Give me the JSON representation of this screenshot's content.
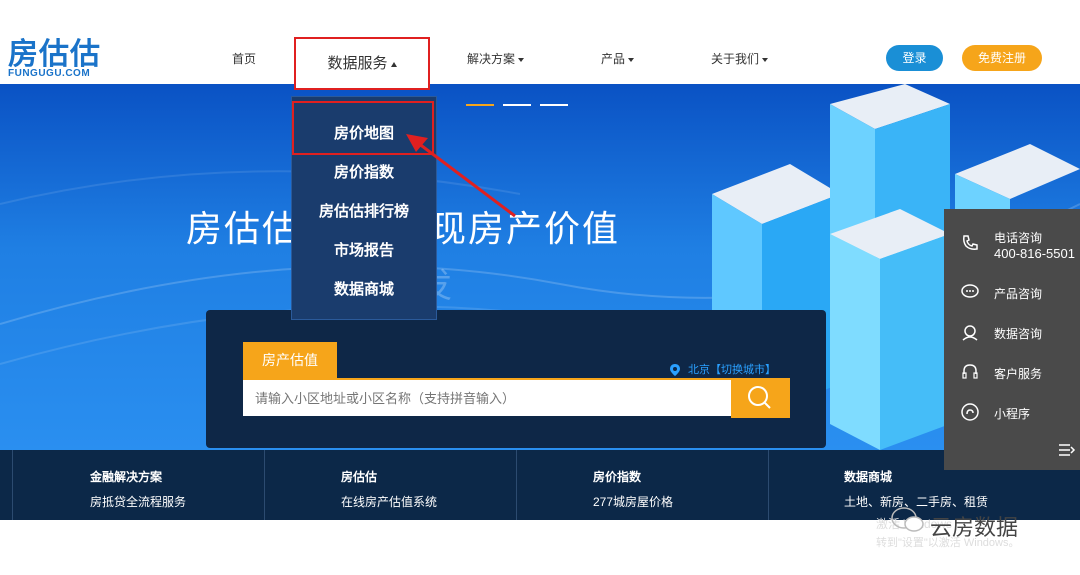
{
  "header": {
    "logo": "房估估",
    "logo_sub": "FUNGUGU.COM",
    "nav": {
      "home": "首页",
      "data_services": "数据服务",
      "solutions": "解决方案",
      "products": "产品",
      "about": "关于我们"
    },
    "login": "登录",
    "register": "免费注册"
  },
  "dropdown": {
    "items": [
      "房价地图",
      "房价指数",
      "房估估排行榜",
      "市场报告",
      "数据商城"
    ]
  },
  "hero": {
    "slogan_left": "房估估",
    "slogan_right": "现房产价值",
    "ghost": "发"
  },
  "search": {
    "tab": "房产估值",
    "city": "北京【切换城市】",
    "placeholder": "请输入小区地址或小区名称（支持拼音输入）"
  },
  "features": [
    {
      "title": "金融解决方案",
      "desc": "房抵贷全流程服务"
    },
    {
      "title": "房估估",
      "desc": "在线房产估值系统"
    },
    {
      "title": "房价指数",
      "desc": "277城房屋价格"
    },
    {
      "title": "数据商城",
      "desc": "土地、新房、二手房、租赁"
    }
  ],
  "side": {
    "phone_label": "电话咨询",
    "phone_number": "400-816-5501",
    "product": "产品咨询",
    "data": "数据咨询",
    "service": "客户服务",
    "mini": "小程序"
  },
  "watermark": {
    "brand": "云房数据",
    "activate": "激活 Windows",
    "activate_sub": "转到\"设置\"以激活 Windows。"
  },
  "colors": {
    "brand_blue": "#1a73c9",
    "orange": "#f6a51a",
    "login_blue": "#1a8fd6",
    "highlight_red": "#e02020"
  }
}
